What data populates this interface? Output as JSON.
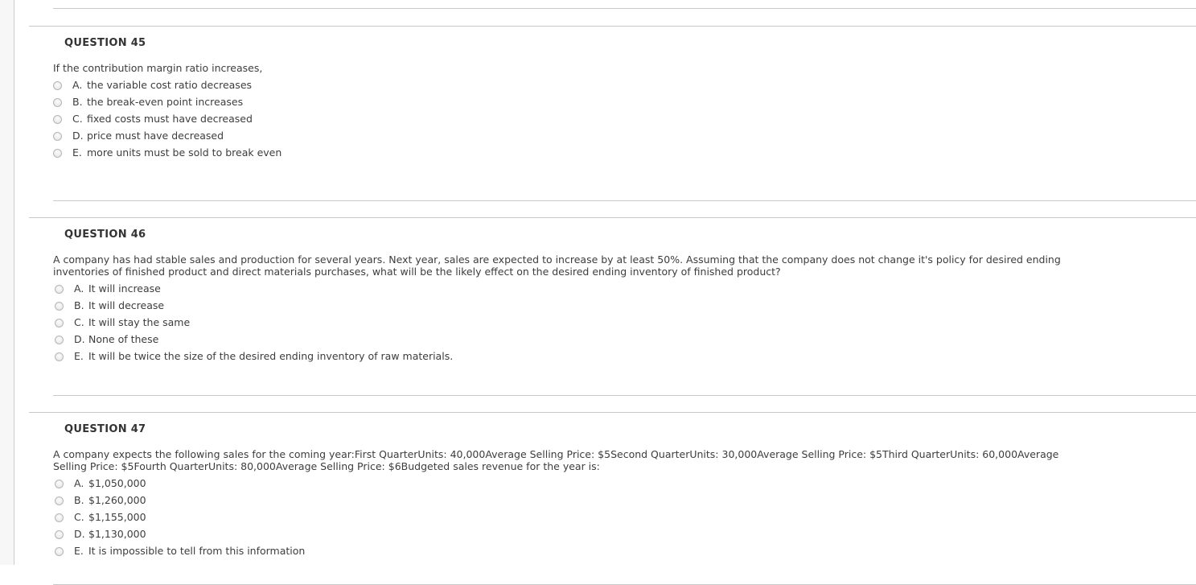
{
  "page": {
    "background_color": "#ffffff",
    "text_color": "#3d3d3d",
    "heading_color": "#333333",
    "rule_color": "#c8c8c8",
    "gutter_color": "#f7f7f7",
    "gutter_border_color": "#cccccc"
  },
  "questions": [
    {
      "heading": "QUESTION 45",
      "prompt": "If the contribution margin ratio increases,",
      "options": [
        {
          "letter": "A.",
          "text": "the variable cost ratio decreases"
        },
        {
          "letter": "B.",
          "text": "the break-even point increases"
        },
        {
          "letter": "C.",
          "text": "fixed costs must have decreased"
        },
        {
          "letter": "D.",
          "text": "price must have decreased"
        },
        {
          "letter": "E.",
          "text": "more units must be sold to break even"
        }
      ]
    },
    {
      "heading": "QUESTION 46",
      "prompt": "A company has had stable sales and production for several years. Next year, sales are expected to increase by at least 50%. Assuming that the company does not change it's policy for desired ending inventories of finished product and direct materials purchases, what will be the likely effect on the desired ending inventory of finished product?",
      "options": [
        {
          "letter": "A.",
          "text": "It will increase"
        },
        {
          "letter": "B.",
          "text": "It will decrease"
        },
        {
          "letter": "C.",
          "text": "It will stay the same"
        },
        {
          "letter": "D.",
          "text": "None of these"
        },
        {
          "letter": "E.",
          "text": "It will be twice the size of the desired ending inventory of raw materials."
        }
      ]
    },
    {
      "heading": "QUESTION 47",
      "prompt": "A company expects the following sales for the coming year:First QuarterUnits: 40,000Average Selling Price: $5Second QuarterUnits: 30,000Average Selling Price: $5Third QuarterUnits: 60,000Average Selling Price: $5Fourth QuarterUnits: 80,000Average Selling Price: $6Budgeted sales revenue for the year is:",
      "options": [
        {
          "letter": "A.",
          "text": "$1,050,000"
        },
        {
          "letter": "B.",
          "text": "$1,260,000"
        },
        {
          "letter": "C.",
          "text": "$1,155,000"
        },
        {
          "letter": "D.",
          "text": "$1,130,000"
        },
        {
          "letter": "E.",
          "text": "It is impossible to tell from this information"
        }
      ]
    }
  ]
}
